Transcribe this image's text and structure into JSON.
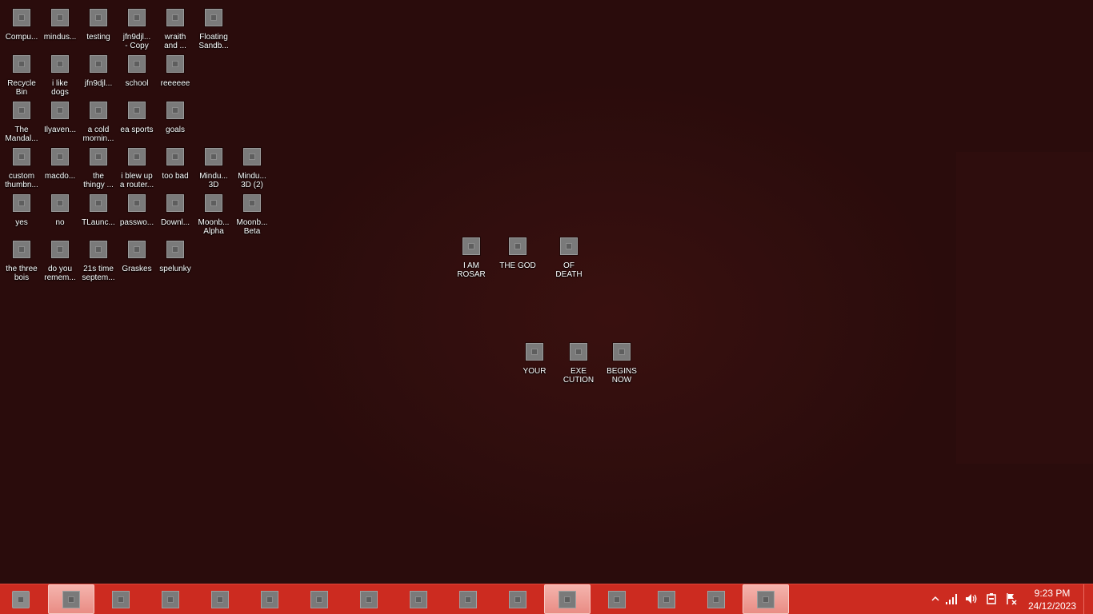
{
  "desktop": {
    "icons": [
      {
        "label": "Compu...",
        "icon": "computer-icon"
      },
      {
        "label": "mindus...",
        "icon": "file-icon"
      },
      {
        "label": "testing",
        "icon": "file-icon"
      },
      {
        "label": "jfn9djl...\n- Copy",
        "icon": "file-icon"
      },
      {
        "label": "wraith\nand ...",
        "icon": "file-icon"
      },
      {
        "label": "Floating\nSandb...",
        "icon": "file-icon"
      },
      {
        "label": "Recycle\nBin",
        "icon": "recycle-bin-icon"
      },
      {
        "label": "i like\ndogs",
        "icon": "file-icon"
      },
      {
        "label": "jfn9djl...",
        "icon": "file-icon"
      },
      {
        "label": "school",
        "icon": "file-icon"
      },
      {
        "label": "reeeeee",
        "icon": "file-icon"
      },
      {
        "label": "The\nMandal...",
        "icon": "file-icon"
      },
      {
        "label": "Ilyaven...",
        "icon": "file-icon"
      },
      {
        "label": "a cold\nmornin...",
        "icon": "file-icon"
      },
      {
        "label": "ea sports",
        "icon": "file-icon"
      },
      {
        "label": "goals",
        "icon": "file-icon"
      },
      {
        "label": "custom\nthumbn...",
        "icon": "file-icon"
      },
      {
        "label": "macdo...",
        "icon": "file-icon"
      },
      {
        "label": "the\nthingy ...",
        "icon": "file-icon"
      },
      {
        "label": "i blew up\na router...",
        "icon": "file-icon"
      },
      {
        "label": "too bad",
        "icon": "file-icon"
      },
      {
        "label": "Mindu...\n3D",
        "icon": "file-icon"
      },
      {
        "label": "Mindu...\n3D (2)",
        "icon": "file-icon"
      },
      {
        "label": "yes",
        "icon": "file-icon"
      },
      {
        "label": "no",
        "icon": "file-icon"
      },
      {
        "label": "TLaunc...",
        "icon": "file-icon"
      },
      {
        "label": "passwo...",
        "icon": "file-icon"
      },
      {
        "label": "Downl...",
        "icon": "file-icon"
      },
      {
        "label": "Moonb...\nAlpha",
        "icon": "file-icon"
      },
      {
        "label": "Moonb...\nBeta",
        "icon": "file-icon"
      },
      {
        "label": "the three\nbois",
        "icon": "file-icon"
      },
      {
        "label": "do you\nremem...",
        "icon": "file-icon"
      },
      {
        "label": "21s time\nseptem...",
        "icon": "file-icon"
      },
      {
        "label": "Graskes",
        "icon": "file-icon"
      },
      {
        "label": "spelunky",
        "icon": "file-icon"
      },
      {
        "label": "I AM\nROSAR",
        "icon": "file-icon"
      },
      {
        "label": "THE GOD",
        "icon": "file-icon"
      },
      {
        "label": "OF\nDEATH",
        "icon": "file-icon"
      },
      {
        "label": "YOUR",
        "icon": "file-icon"
      },
      {
        "label": "EXE\nCUTION",
        "icon": "file-icon"
      },
      {
        "label": "BEGINS\nNOW",
        "icon": "file-icon"
      }
    ]
  },
  "taskbar": {
    "start_icon": "start-orb-icon",
    "buttons": [
      {
        "icon": "app-icon",
        "active": true
      },
      {
        "icon": "app-icon",
        "active": false
      },
      {
        "icon": "app-icon",
        "active": false
      },
      {
        "icon": "app-icon",
        "active": false
      },
      {
        "icon": "app-icon",
        "active": false
      },
      {
        "icon": "app-icon",
        "active": false
      },
      {
        "icon": "app-icon",
        "active": false
      },
      {
        "icon": "app-icon",
        "active": false
      },
      {
        "icon": "app-icon",
        "active": false
      },
      {
        "icon": "app-icon",
        "active": false
      },
      {
        "icon": "app-icon",
        "active": true
      },
      {
        "icon": "app-icon",
        "active": false
      },
      {
        "icon": "app-icon",
        "active": false
      },
      {
        "icon": "app-icon",
        "active": false
      },
      {
        "icon": "app-icon",
        "active": true
      }
    ],
    "tray": {
      "icons": [
        "show-hidden-icons-icon",
        "network-signal-icon",
        "volume-icon",
        "power-icon",
        "action-center-flag-icon"
      ],
      "time": "9:23 PM",
      "date": "24/12/2023"
    }
  },
  "colors": {
    "desktop_background": "#2a0c0c",
    "taskbar": "#cc2b20",
    "taskbar_active": "#f0a8a0"
  }
}
